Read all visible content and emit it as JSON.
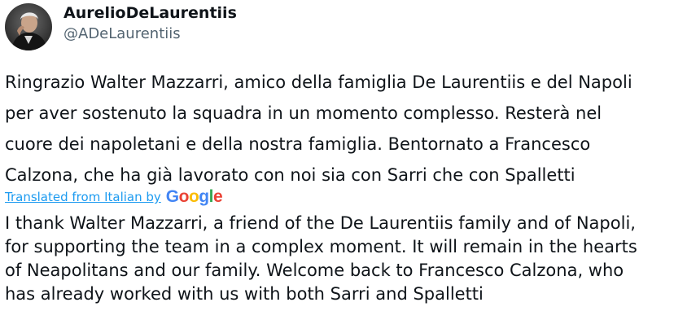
{
  "author": {
    "display_name": "AurelioDeLaurentiis",
    "handle": "@ADeLaurentiis",
    "avatar_icon": "profile-photo"
  },
  "tweet": {
    "original_lines": [
      "Ringrazio Walter Mazzarri, amico della famiglia De Laurentiis e del Napoli",
      "per aver sostenuto la squadra in un momento complesso. Resterà nel",
      "cuore dei napoletani e della nostra famiglia. Bentornato a Francesco",
      "Calzona, che ha già lavorato con noi sia con Sarri che con Spalletti"
    ],
    "translated_from_label": "Translated from Italian by",
    "translator_logo": {
      "text": "Google",
      "colors": [
        "#4285F4",
        "#EA4335",
        "#FBBC05",
        "#4285F4",
        "#34A853",
        "#EA4335"
      ]
    },
    "translation_lines": [
      "I thank Walter Mazzarri, a friend of the De Laurentiis family and of Napoli,",
      "for supporting the team in a complex moment. It will remain in the hearts",
      "of Neapolitans and our family. Welcome back to Francesco Calzona, who",
      "has already worked with us with both Sarri and Spalletti"
    ]
  },
  "colors": {
    "text": "#0f1419",
    "secondary": "#536471",
    "link": "#1d9bf0",
    "background": "#ffffff"
  }
}
